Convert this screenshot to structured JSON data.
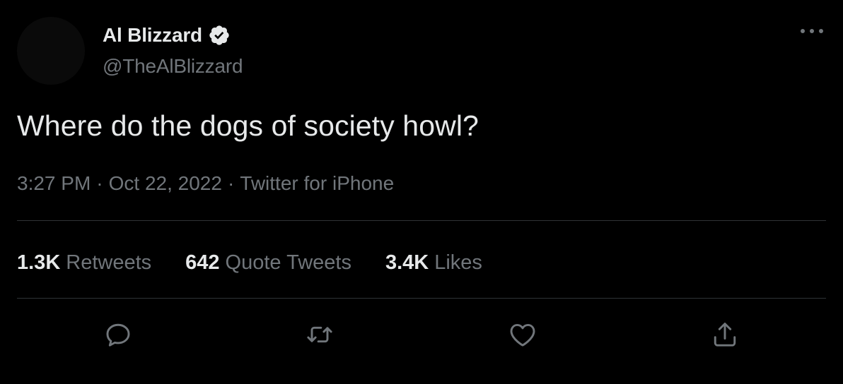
{
  "author": {
    "display_name": "Al Blizzard",
    "handle": "@TheAlBlizzard",
    "verified": true
  },
  "tweet": {
    "text": "Where do the dogs of society howl?",
    "time": "3:27 PM",
    "separator1": "·",
    "date": "Oct 22, 2022",
    "separator2": "·",
    "source": "Twitter for iPhone"
  },
  "stats": {
    "retweets": {
      "count": "1.3K",
      "label": "Retweets"
    },
    "quotes": {
      "count": "642",
      "label": "Quote Tweets"
    },
    "likes": {
      "count": "3.4K",
      "label": "Likes"
    }
  },
  "icons": {
    "more": "more-horizontal-icon",
    "reply": "reply-icon",
    "retweet": "retweet-icon",
    "like": "heart-icon",
    "share": "share-icon",
    "verified": "verified-badge-icon"
  },
  "colors": {
    "background": "#000000",
    "primary_text": "#e7e9ea",
    "secondary_text": "#71767b",
    "divider": "#2f3336"
  }
}
